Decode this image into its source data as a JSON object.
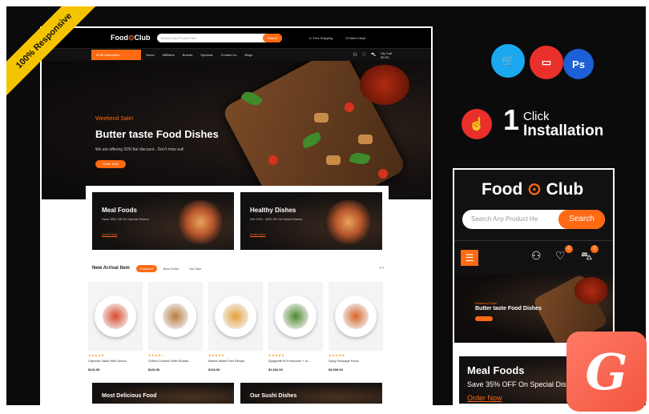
{
  "ribbon": {
    "text": "100% Responsive"
  },
  "desktop": {
    "logo_left": "Food",
    "logo_right": "Club",
    "search": {
      "placeholder": "Search Any Product Here",
      "button": "Search"
    },
    "free_shipping": "Free Shipping",
    "need_help": "Need Help?",
    "categories_button": "All Categories",
    "nav": [
      "Home",
      "Affiliates",
      "Brands",
      "Specials",
      "Contact Us",
      "Blogs"
    ],
    "cart_label": "My Cart",
    "cart_value": "$0.00",
    "hero": {
      "kicker": "Weekend Sale!",
      "title": "Butter taste Food Dishes",
      "subtitle": "We are offering 20% flat discount.. Don't miss out!",
      "button": "Order Now"
    },
    "banners": [
      {
        "title": "Meal Foods",
        "subtitle": "Save 35% Off On Special Dishes",
        "link": "Order Now"
      },
      {
        "title": "Healthy Dishes",
        "subtitle": "Get 15% - 35% Off On Sweet Dishes",
        "link": "Order Now"
      }
    ],
    "new_arrival": {
      "title": "New Arrival Item",
      "tabs": [
        "Featured",
        "Best Seller",
        "Hot Sale"
      ],
      "arrows": "‹ ›"
    },
    "products": [
      {
        "name": "Caprese Salad With Avoca...",
        "price": "$241.99",
        "rating": "★★★★★",
        "plate_color": "#d9482b"
      },
      {
        "name": "Grilled Chicken With Roaste...",
        "price": "$132.90",
        "rating": "★★★★☆",
        "plate_color": "#b87a3f"
      },
      {
        "name": "Baked Italian Fish Recipe",
        "price": "$132.90",
        "rating": "★★★★★",
        "plate_color": "#e8a03a"
      },
      {
        "name": "Spaghetti W Pomodoro + Ix...",
        "price": "$1,302.00",
        "rating": "★★★★★",
        "plate_color": "#4c8a2e"
      },
      {
        "name": "Spicy Sausage Pizza",
        "price": "$2,009.00",
        "rating": "★★★★★",
        "plate_color": "#d9652b"
      }
    ],
    "bottom_banners": [
      "Most Delicious Food",
      "Our Sushi Dishes"
    ]
  },
  "features": {
    "badges": [
      {
        "label": "🛒",
        "color": "#1aa9f0"
      },
      {
        "label": "▭",
        "color": "#e9302a"
      },
      {
        "label": "Ps",
        "color": "#1d5fd4"
      }
    ],
    "install_icon": "☝",
    "install_number": "1",
    "install_click": "Click",
    "install_text": "Installation"
  },
  "mobile": {
    "logo_left": "Food",
    "logo_right": "Club",
    "search_placeholder": "Search Any Product He",
    "search_button": "Search",
    "menu_icon": "☰",
    "user_icon": "👤",
    "wishlist_icon": "♡",
    "cart_icon": "🛒",
    "wishlist_count": "0",
    "cart_count": "0",
    "hero_kicker": "Weekend Sale!",
    "hero_title": "Butter taste Food Dishes",
    "banner_title": "Meal Foods",
    "banner_subtitle": "Save 35% OFF On Special Dishes",
    "banner_link": "Order Now"
  },
  "brand_logo": "G"
}
